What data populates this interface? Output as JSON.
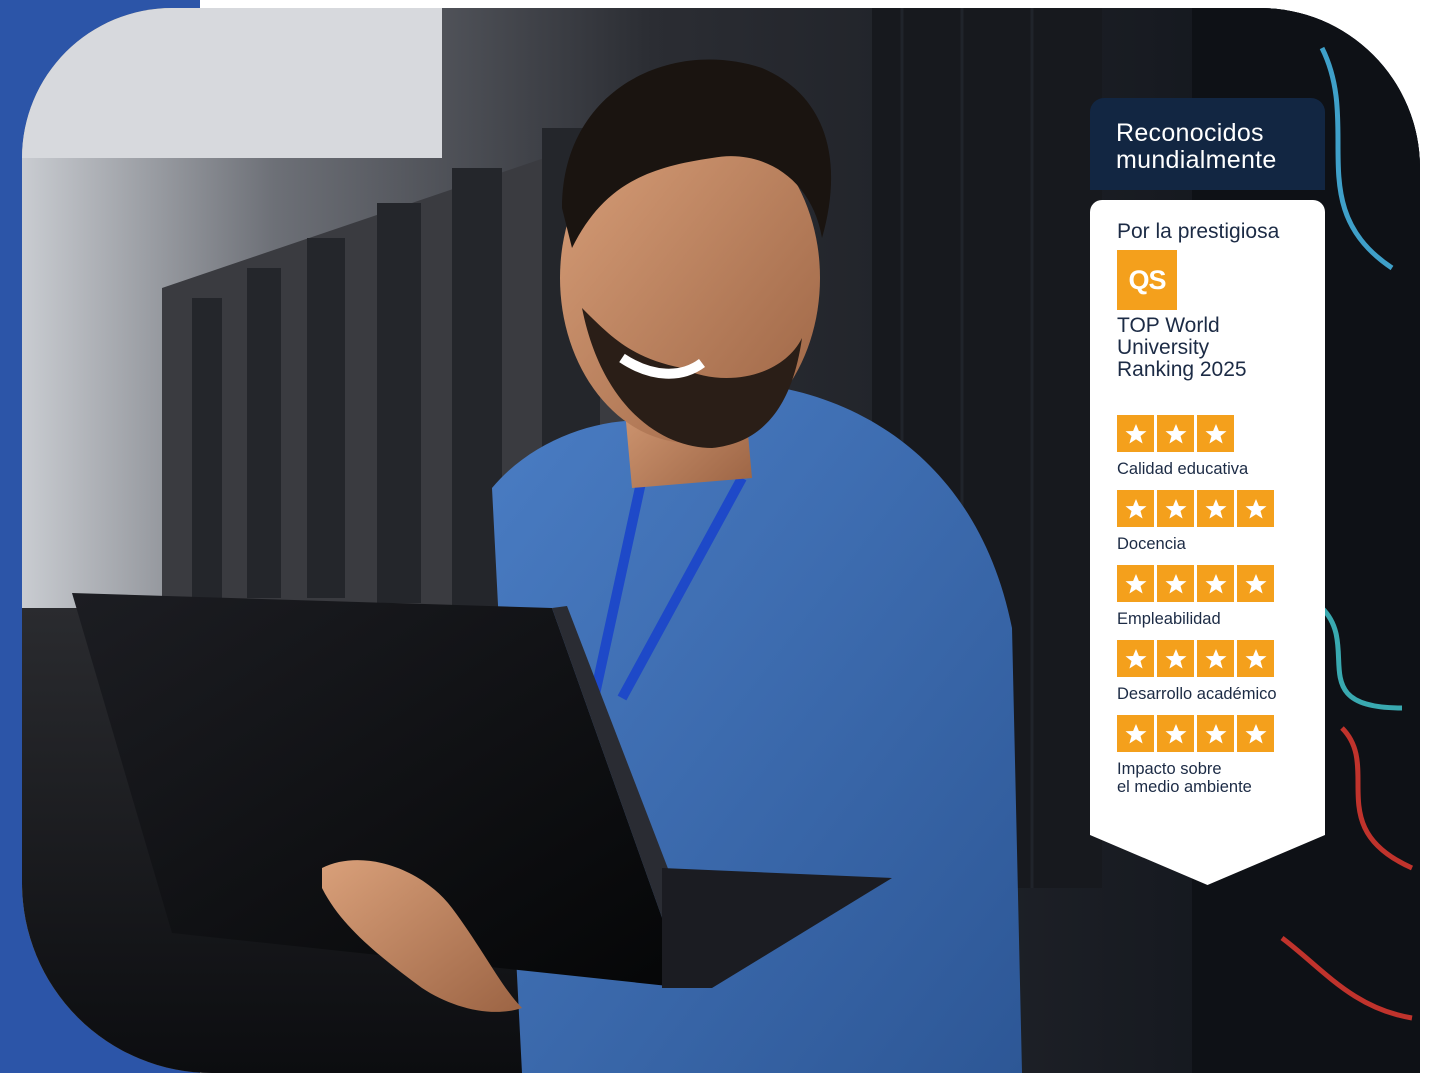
{
  "colors": {
    "accent_blue": "#2c55a8",
    "badge_navy": "#122642",
    "qs_orange": "#f4a01c",
    "star_orange": "#f4a01c"
  },
  "photo": {
    "icon": "photo-icon"
  },
  "badge": {
    "header_lines": [
      "Reconocidos",
      "mundialmente"
    ],
    "intro": "Por la prestigiosa",
    "logo_text": "QS",
    "ranking_title_lines": [
      "TOP World",
      "University",
      "Ranking 2025"
    ],
    "metrics": [
      {
        "stars": 3,
        "label_lines": [
          "Calidad educativa"
        ]
      },
      {
        "stars": 4,
        "label_lines": [
          "Docencia"
        ]
      },
      {
        "stars": 4,
        "label_lines": [
          "Empleabilidad"
        ]
      },
      {
        "stars": 4,
        "label_lines": [
          "Desarrollo académico"
        ]
      },
      {
        "stars": 4,
        "label_lines": [
          "Impacto sobre",
          "el medio ambiente"
        ]
      }
    ]
  }
}
